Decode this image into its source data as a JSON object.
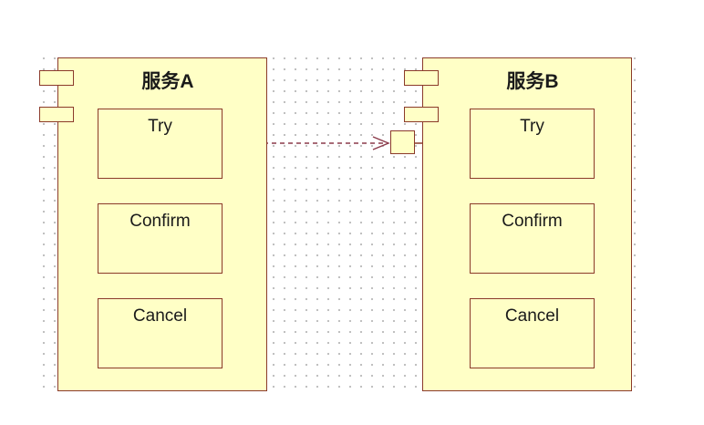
{
  "diagram": {
    "service_a": {
      "title": "服务A",
      "methods": [
        "Try",
        "Confirm",
        "Cancel"
      ]
    },
    "service_b": {
      "title": "服务B",
      "methods": [
        "Try",
        "Confirm",
        "Cancel"
      ]
    },
    "colors": {
      "fill": "#ffffc6",
      "stroke": "#8b3a2a",
      "grid_dot": "#b9b9b9",
      "dependency_line": "#8b3a4a"
    }
  }
}
